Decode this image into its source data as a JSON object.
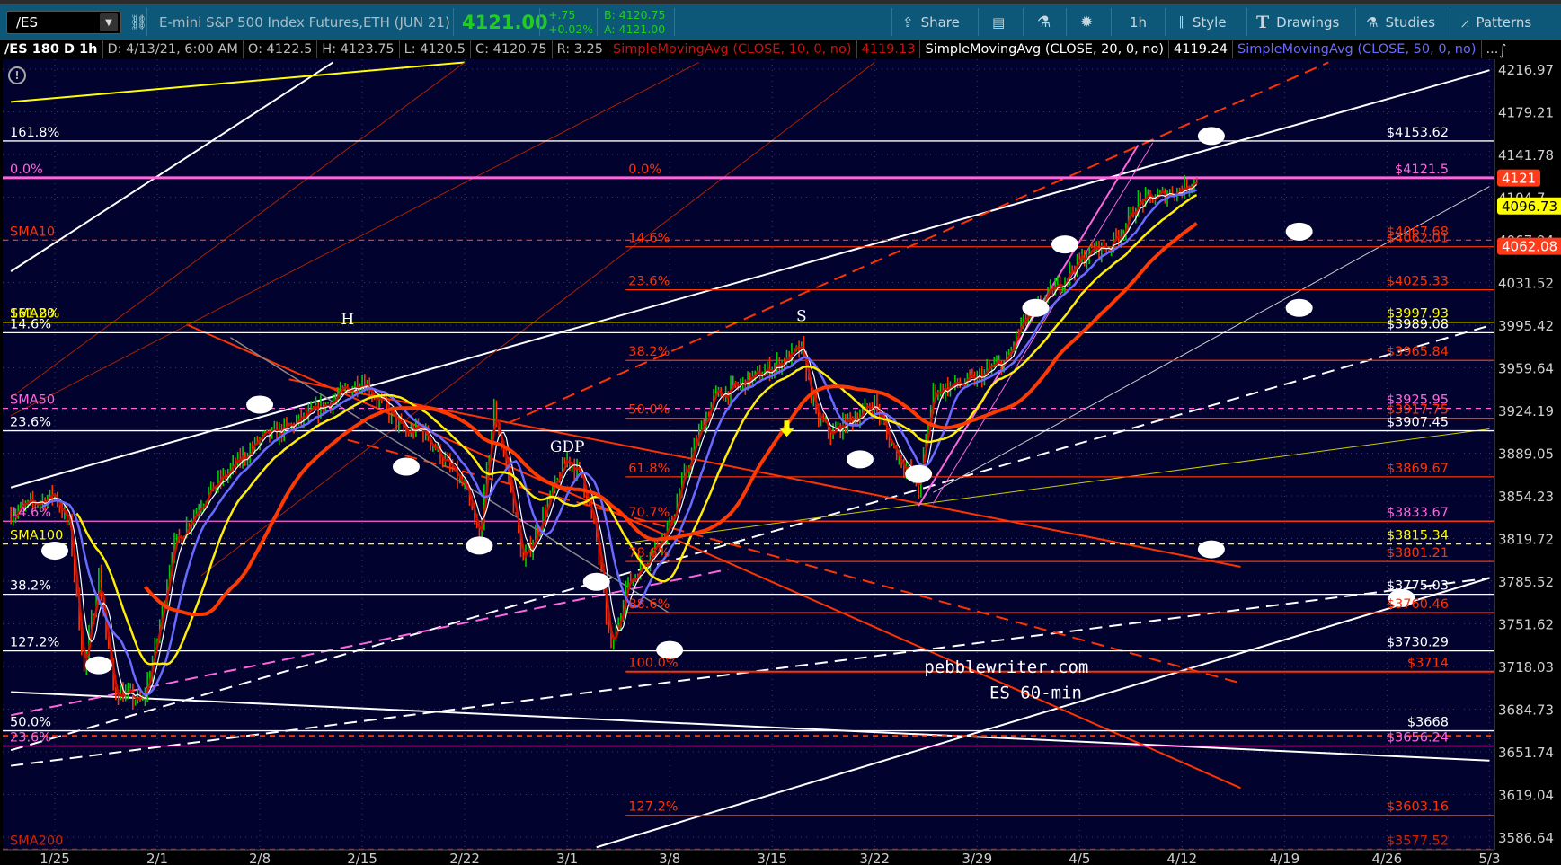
{
  "toolbar": {
    "symbol": "/ES",
    "description": "E-mini S&P 500 Index Futures,ETH (JUN 21)",
    "last": "4121.00",
    "change": "+.75",
    "change_pct": "+0.02%",
    "bid": "B: 4120.75",
    "ask": "A: 4121.00",
    "share": "Share",
    "interval": "1h",
    "style": "Style",
    "drawings": "Drawings",
    "studies": "Studies",
    "patterns": "Patterns",
    "icons": [
      "link-icon",
      "share-icon",
      "news-icon",
      "flask-icon",
      "gear-icon",
      "style-icon",
      "drawings-icon",
      "studies-icon",
      "patterns-icon"
    ]
  },
  "infobar": {
    "chart_id": "/ES 180 D 1h",
    "date": "D: 4/13/21, 6:00 AM",
    "open": "O: 4122.5",
    "high": "H: 4123.75",
    "low": "L: 4120.5",
    "close": "C: 4120.75",
    "range": "R: 3.25",
    "sma10": "SimpleMovingAvg (CLOSE, 10, 0, no)",
    "sma10_value": "4119.13",
    "sma20": "SimpleMovingAvg (CLOSE, 20, 0, no)",
    "sma20_value": "4119.24",
    "sma50": "SimpleMovingAvg (CLOSE, 50, 0, no)",
    "more": "..."
  },
  "colors": {
    "up": "#00cc00",
    "down": "#ff3300",
    "sma10": "#cc1100",
    "sma20": "#ffffff",
    "sma50": "#6a6aff",
    "sma100": "#ffee00",
    "sma200": "#ff3a00",
    "background": "#02022e",
    "white": "#ffffff",
    "pink": "#ff66dd",
    "orange": "#ff3300",
    "yellow": "#ffff00"
  },
  "chart_data": {
    "type": "candlestick",
    "scale": "log",
    "ylim": [
      3586.64,
      4216.97
    ],
    "xlim": [
      "2021-01-22",
      "2021-05-03"
    ],
    "grid": true,
    "y_ticks": [
      "4216.97",
      "4179.21",
      "4141.78",
      "4104.7",
      "4067.94",
      "4031.52",
      "3995.42",
      "3959.64",
      "3924.19",
      "3889.05",
      "3854.23",
      "3819.72",
      "3785.52",
      "3751.62",
      "3718.03",
      "3684.73",
      "3651.74",
      "3619.04",
      "3586.64"
    ],
    "x_ticks": [
      {
        "label": "1/25",
        "date": "2021-01-25"
      },
      {
        "label": "2/1",
        "date": "2021-02-01"
      },
      {
        "label": "2/8",
        "date": "2021-02-08"
      },
      {
        "label": "2/15",
        "date": "2021-02-15"
      },
      {
        "label": "2/22",
        "date": "2021-02-22"
      },
      {
        "label": "3/1",
        "date": "2021-03-01"
      },
      {
        "label": "3/8",
        "date": "2021-03-08"
      },
      {
        "label": "3/15",
        "date": "2021-03-15"
      },
      {
        "label": "3/22",
        "date": "2021-03-22"
      },
      {
        "label": "3/29",
        "date": "2021-03-29"
      },
      {
        "label": "4/5",
        "date": "2021-04-05"
      },
      {
        "label": "4/12",
        "date": "2021-04-12"
      },
      {
        "label": "4/19",
        "date": "2021-04-19"
      },
      {
        "label": "4/26",
        "date": "2021-04-26"
      },
      {
        "label": "5/3",
        "date": "2021-05-03"
      }
    ],
    "price_path": [
      [
        "2021-01-22",
        3840
      ],
      [
        "2021-01-24",
        3850
      ],
      [
        "2021-01-25",
        3855
      ],
      [
        "2021-01-26",
        3830
      ],
      [
        "2021-01-27",
        3715
      ],
      [
        "2021-01-28",
        3790
      ],
      [
        "2021-01-29",
        3700
      ],
      [
        "2021-01-31",
        3690
      ],
      [
        "2021-02-01",
        3740
      ],
      [
        "2021-02-02",
        3810
      ],
      [
        "2021-02-04",
        3850
      ],
      [
        "2021-02-08",
        3900
      ],
      [
        "2021-02-10",
        3910
      ],
      [
        "2021-02-12",
        3925
      ],
      [
        "2021-02-15",
        3950
      ],
      [
        "2021-02-18",
        3905
      ],
      [
        "2021-02-19",
        3910
      ],
      [
        "2021-02-22",
        3860
      ],
      [
        "2021-02-23",
        3820
      ],
      [
        "2021-02-24",
        3925
      ],
      [
        "2021-02-25",
        3870
      ],
      [
        "2021-02-26",
        3800
      ],
      [
        "2021-03-01",
        3885
      ],
      [
        "2021-03-02",
        3870
      ],
      [
        "2021-03-03",
        3820
      ],
      [
        "2021-03-04",
        3730
      ],
      [
        "2021-03-05",
        3780
      ],
      [
        "2021-03-08",
        3830
      ],
      [
        "2021-03-09",
        3870
      ],
      [
        "2021-03-10",
        3905
      ],
      [
        "2021-03-11",
        3935
      ],
      [
        "2021-03-12",
        3940
      ],
      [
        "2021-03-15",
        3960
      ],
      [
        "2021-03-17",
        3975
      ],
      [
        "2021-03-18",
        3920
      ],
      [
        "2021-03-19",
        3905
      ],
      [
        "2021-03-22",
        3930
      ],
      [
        "2021-03-23",
        3900
      ],
      [
        "2021-03-24",
        3880
      ],
      [
        "2021-03-25",
        3860
      ],
      [
        "2021-03-26",
        3940
      ],
      [
        "2021-03-29",
        3950
      ],
      [
        "2021-03-30",
        3960
      ],
      [
        "2021-03-31",
        3965
      ],
      [
        "2021-04-01",
        3995
      ],
      [
        "2021-04-05",
        4050
      ],
      [
        "2021-04-06",
        4060
      ],
      [
        "2021-04-07",
        4062
      ],
      [
        "2021-04-08",
        4078
      ],
      [
        "2021-04-09",
        4100
      ],
      [
        "2021-04-12",
        4112
      ],
      [
        "2021-04-13",
        4120.75
      ]
    ],
    "moving_averages": [
      {
        "name": "SMA10",
        "color": "#cc1100"
      },
      {
        "name": "SMA20",
        "color": "#ffffff"
      },
      {
        "name": "SMA50",
        "color": "#6a6aff"
      },
      {
        "name": "SMA100",
        "color": "#ffee00"
      },
      {
        "name": "SMA200",
        "color": "#ff3a00"
      }
    ],
    "levels": [
      {
        "price": 4153.62,
        "color": "#ffffff",
        "right": "$4153.62",
        "left": "161.8%"
      },
      {
        "price": 4121.5,
        "color": "#ff66dd",
        "right": "$4121.5",
        "left": "0.0%",
        "width": 3
      },
      {
        "price": 4121.5,
        "color": "#ff3300",
        "mid": "0.0%",
        "from": "2021-03-05",
        "hidden_line": true
      },
      {
        "price": 4067.68,
        "color": "#ff3300",
        "right": "$4067.68",
        "left": "SMA10",
        "dash": true
      },
      {
        "price": 4062.01,
        "color": "#ff3300",
        "right": "$4062.01",
        "mid": "14.6%",
        "from": "2021-03-05"
      },
      {
        "price": 4025.33,
        "color": "#ff3300",
        "right": "$4025.33",
        "mid": "23.6%",
        "from": "2021-03-05"
      },
      {
        "price": 3997.93,
        "color": "#ffff00",
        "right": "$3997.93",
        "left": "SMA20",
        "left2": "161.8%"
      },
      {
        "price": 3989.08,
        "color": "#ffffff",
        "right": "$3989.08",
        "left": "14.6%"
      },
      {
        "price": 3965.84,
        "color": "#ff3300",
        "right": "$3965.84",
        "mid": "38.2%",
        "from": "2021-03-05"
      },
      {
        "price": 3925.95,
        "color": "#ff66dd",
        "right": "$3925.95",
        "left": "SMA50",
        "dash": true
      },
      {
        "price": 3917.75,
        "color": "#ff3300",
        "right": "$3917.75",
        "mid": "50.0%",
        "from": "2021-03-05"
      },
      {
        "price": 3907.45,
        "color": "#ffffff",
        "right": "$3907.45",
        "left": "23.6%"
      },
      {
        "price": 3869.67,
        "color": "#ff3300",
        "right": "$3869.67",
        "mid": "61.8%",
        "from": "2021-03-05"
      },
      {
        "price": 3833.67,
        "color": "#ff66dd",
        "right": "$3833.67",
        "left": "14.6%"
      },
      {
        "price": 3833.67,
        "color": "#ff3300",
        "mid": "70.7%",
        "from": "2021-03-05"
      },
      {
        "price": 3815.34,
        "color": "#ffff00",
        "right": "$3815.34",
        "left": "SMA100",
        "dash": true
      },
      {
        "price": 3801.21,
        "color": "#ff3300",
        "right": "$3801.21",
        "mid": "78.6%",
        "from": "2021-03-05"
      },
      {
        "price": 3775.03,
        "color": "#ffffff",
        "right": "$3775.03",
        "left": "38.2%"
      },
      {
        "price": 3760.46,
        "color": "#ff3300",
        "right": "$3760.46",
        "mid": "88.6%",
        "from": "2021-03-05"
      },
      {
        "price": 3730.29,
        "color": "#ffffff",
        "right": "$3730.29",
        "left": "127.2%"
      },
      {
        "price": 3714,
        "color": "#ff3300",
        "right": "$3714",
        "mid": "100.0%",
        "from": "2021-03-05",
        "width": 2
      },
      {
        "price": 3668,
        "color": "#ffffff",
        "right": "$3668",
        "left": "50.0%"
      },
      {
        "price": 3664,
        "color": "#ff3300",
        "dash": true,
        "width": 2
      },
      {
        "price": 3656.24,
        "color": "#ff66dd",
        "right": "$3656.24",
        "left": "23.6%"
      },
      {
        "price": 3603.16,
        "color": "#ff3300",
        "right": "$3603.16",
        "mid": "127.2%",
        "from": "2021-03-05"
      },
      {
        "price": 3577.52,
        "color": "#cc2200",
        "right": "$3577.52",
        "left": "SMA200",
        "dash": true
      }
    ],
    "trendlines": [
      {
        "p1": [
          "2021-01-22",
          3861
        ],
        "p2": [
          "2021-05-03",
          4216
        ],
        "color": "#ffffff",
        "width": 2
      },
      {
        "p1": [
          "2021-01-22",
          4041
        ],
        "p2": [
          "2021-02-13",
          4223
        ],
        "color": "#ffffff",
        "width": 2
      },
      {
        "p1": [
          "2021-01-22",
          4188
        ],
        "p2": [
          "2021-02-22",
          4223
        ],
        "color": "#ffff00",
        "width": 2
      },
      {
        "p1": [
          "2021-02-25",
          3914
        ],
        "p2": [
          "2021-04-22",
          4223
        ],
        "color": "#ff3300",
        "width": 2,
        "dash": true
      },
      {
        "p1": [
          "2021-01-22",
          3653
        ],
        "p2": [
          "2021-05-03",
          3995
        ],
        "color": "#ffffff",
        "width": 2,
        "dash": true
      },
      {
        "p1": [
          "2021-01-22",
          3641
        ],
        "p2": [
          "2021-05-03",
          3788
        ],
        "color": "#ffffff",
        "width": 2,
        "dash": true
      },
      {
        "p1": [
          "2021-03-03",
          3579
        ],
        "p2": [
          "2021-05-03",
          3788
        ],
        "color": "#ffffff",
        "width": 2
      },
      {
        "p1": [
          "2021-01-22",
          3698
        ],
        "p2": [
          "2021-05-03",
          3645
        ],
        "color": "#ffffff",
        "width": 2
      },
      {
        "p1": [
          "2021-02-03",
          3996
        ],
        "p2": [
          "2021-04-16",
          3624
        ],
        "color": "#ff3300",
        "width": 2
      },
      {
        "p1": [
          "2021-02-10",
          3950
        ],
        "p2": [
          "2021-04-16",
          3797
        ],
        "color": "#ff3300",
        "width": 2
      },
      {
        "p1": [
          "2021-02-14",
          3900
        ],
        "p2": [
          "2021-04-16",
          3705
        ],
        "color": "#ff3300",
        "width": 2,
        "dash": true
      },
      {
        "p1": [
          "2021-03-26",
          3857
        ],
        "p2": [
          "2021-05-03",
          4114
        ],
        "color": "#cccccc",
        "width": 1
      },
      {
        "p1": [
          "2021-03-05",
          3816
        ],
        "p2": [
          "2021-05-03",
          3909
        ],
        "color": "#cccc00",
        "width": 1
      },
      {
        "p1": [
          "2021-03-25",
          3846
        ],
        "p2": [
          "2021-04-09",
          4150
        ],
        "color": "#ff66dd",
        "width": 2
      },
      {
        "p1": [
          "2021-03-26",
          3848
        ],
        "p2": [
          "2021-04-10",
          4152
        ],
        "color": "#ff66dd",
        "width": 1
      },
      {
        "p1": [
          "2021-01-22",
          3680
        ],
        "p2": [
          "2021-03-12",
          3795
        ],
        "color": "#ff66dd",
        "width": 2,
        "dash": true
      },
      {
        "p1": [
          "2021-01-22",
          3935
        ],
        "p2": [
          "2021-02-22",
          4223
        ],
        "color": "#aa2200",
        "width": 1
      },
      {
        "p1": [
          "2021-01-22",
          3920
        ],
        "p2": [
          "2021-03-10",
          4223
        ],
        "color": "#aa2200",
        "width": 1
      },
      {
        "p1": [
          "2021-02-04",
          3790
        ],
        "p2": [
          "2021-03-22",
          4223
        ],
        "color": "#aa2200",
        "width": 1
      },
      {
        "p1": [
          "2021-02-06",
          3985
        ],
        "p2": [
          "2021-03-08",
          3760
        ],
        "color": "#888888",
        "width": 1.5
      }
    ],
    "markers": [
      [
        "2021-04-14",
        4158
      ],
      [
        "2021-04-20",
        4075
      ],
      [
        "2021-04-20",
        4010
      ],
      [
        "2021-04-02",
        4010
      ],
      [
        "2021-04-04",
        4064
      ],
      [
        "2021-03-21",
        3884
      ],
      [
        "2021-03-25",
        3872
      ],
      [
        "2021-04-14",
        3811
      ],
      [
        "2021-04-27",
        3772
      ],
      [
        "2021-03-08",
        3731
      ],
      [
        "2021-03-03",
        3785
      ],
      [
        "2021-02-23",
        3814
      ],
      [
        "2021-02-18",
        3878
      ],
      [
        "2021-02-08",
        3929
      ],
      [
        "2021-01-28",
        3719
      ],
      [
        "2021-01-25",
        3810
      ]
    ],
    "annotations": [
      {
        "text": "H",
        "date": "2021-02-14",
        "price": 3996,
        "color": "#ffffff"
      },
      {
        "text": "S",
        "date": "2021-03-17",
        "price": 3999,
        "color": "#ffffff"
      },
      {
        "text": "GDP",
        "date": "2021-03-01",
        "price": 3890,
        "color": "#ffffff"
      },
      {
        "text": "pebblewriter.com",
        "date": "2021-03-31",
        "price": 3713,
        "color": "#ffffff"
      },
      {
        "text": "ES 60-min",
        "date": "2021-04-02",
        "price": 3693,
        "color": "#ffffff"
      }
    ],
    "arrow": {
      "date": "2021-03-16",
      "price": 3904,
      "color": "#ffff00",
      "direction": "down"
    },
    "badges": [
      {
        "text": "4121",
        "price": 4121,
        "color": "#ff3b1a",
        "text_color": "#ffffff"
      },
      {
        "text": "4096.73",
        "price": 4096.73,
        "color": "#ffff00",
        "text_color": "#000000"
      },
      {
        "text": "4062.08",
        "price": 4062.08,
        "color": "#ff3b1a",
        "text_color": "#ffffff"
      }
    ]
  }
}
